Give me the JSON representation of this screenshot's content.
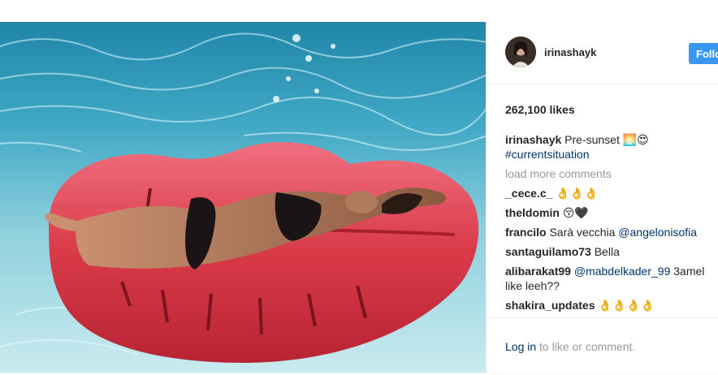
{
  "post": {
    "username": "irinashayk",
    "follow_label": "Follo",
    "likes": "262,100 likes"
  },
  "comments": [
    {
      "user": "irinashayk",
      "text": "Pre-sunset 🌅😍",
      "tag": "#currentsituation"
    },
    {
      "user": "_cece.c_",
      "text": "👌👌👌"
    },
    {
      "user": "theldomin",
      "text": "😚🖤"
    },
    {
      "user": "francilo",
      "text": "Sarà vecchia",
      "mention": "@angelonisofia"
    },
    {
      "user": "santaguilamo73",
      "text": "Bella"
    },
    {
      "user": "alibarakat99",
      "mention": "@mabdelkader_99",
      "text": "3amel like leeh??"
    },
    {
      "user": "shakira_updates",
      "text": "👌👌👌👌"
    }
  ],
  "load_more_label": "load more comments",
  "footer": {
    "login_link": "Log in",
    "login_text": "to like or comment."
  },
  "colors": {
    "follow_button": "#3897f0",
    "link": "#003569",
    "muted": "#999999",
    "float": "#d93a48"
  }
}
